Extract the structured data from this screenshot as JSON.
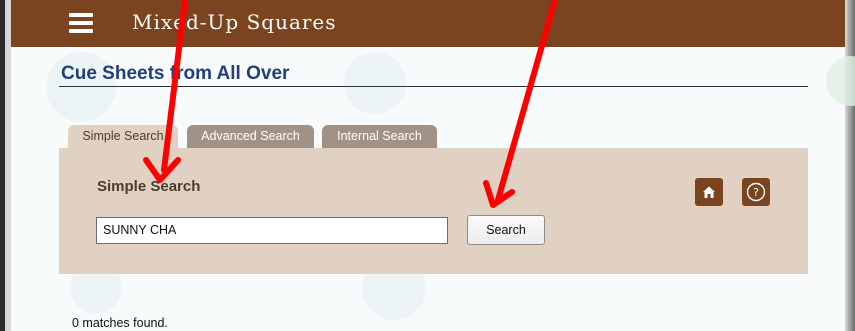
{
  "header": {
    "menu_icon": "hamburger-menu-icon",
    "app_title": "Mixed-Up Squares"
  },
  "page": {
    "title": "Cue Sheets from All Over"
  },
  "tabs": [
    {
      "label": "Simple Search",
      "active": true
    },
    {
      "label": "Advanced Search",
      "active": false
    },
    {
      "label": "Internal Search",
      "active": false
    }
  ],
  "search_panel": {
    "heading": "Simple Search",
    "input_value": "SUNNY CHA",
    "search_button_label": "Search",
    "home_icon": "home-icon",
    "help_icon": "help-icon",
    "help_glyph": "?"
  },
  "results": {
    "status": "0 matches found."
  },
  "annotations": {
    "arrow_color": "#ff0000",
    "arrow_count": 2
  },
  "colors": {
    "header_brown": "#7a4420",
    "panel_tan": "#e0d1c3",
    "inactive_tab": "#a09386",
    "title_blue": "#223f7a"
  }
}
